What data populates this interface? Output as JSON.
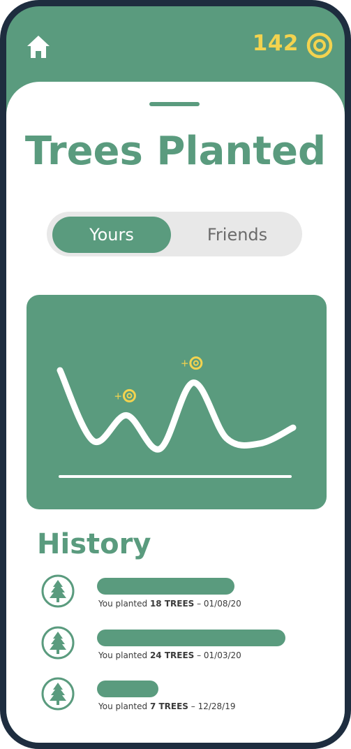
{
  "header": {
    "coin_count": "142"
  },
  "title": "Trees Planted",
  "toggle": {
    "options": [
      "Yours",
      "Friends"
    ],
    "selected": "Yours"
  },
  "chart_data": {
    "type": "line",
    "title": "",
    "xlabel": "",
    "ylabel": "",
    "grid": false,
    "x": [
      0,
      1,
      2,
      3,
      4,
      5,
      6,
      7
    ],
    "series": [
      {
        "values": [
          9.5,
          1.5,
          4.4,
          0.6,
          8.1,
          1.8,
          1.2,
          3.0
        ]
      }
    ],
    "annotations": [
      {
        "label": "+",
        "x": 2,
        "icon": "coin-icon"
      },
      {
        "label": "+",
        "x": 4,
        "icon": "coin-icon"
      }
    ]
  },
  "history": {
    "title": "History",
    "items": [
      {
        "prefix": "You planted ",
        "count": "18 TREES",
        "date": " – 01/08/20",
        "progress": 0.38
      },
      {
        "prefix": "You planted ",
        "count": "24 TREES",
        "date": " – 01/03/20",
        "progress": 0.52
      },
      {
        "prefix": "You planted ",
        "count": "7 TREES",
        "date": " – 12/28/19",
        "progress": 0.17
      }
    ]
  },
  "colors": {
    "brand_green": "#5a9b7e",
    "coin_yellow": "#f3d34f",
    "frame": "#1e2d3f",
    "toggle_bg": "#e8e8e8"
  }
}
